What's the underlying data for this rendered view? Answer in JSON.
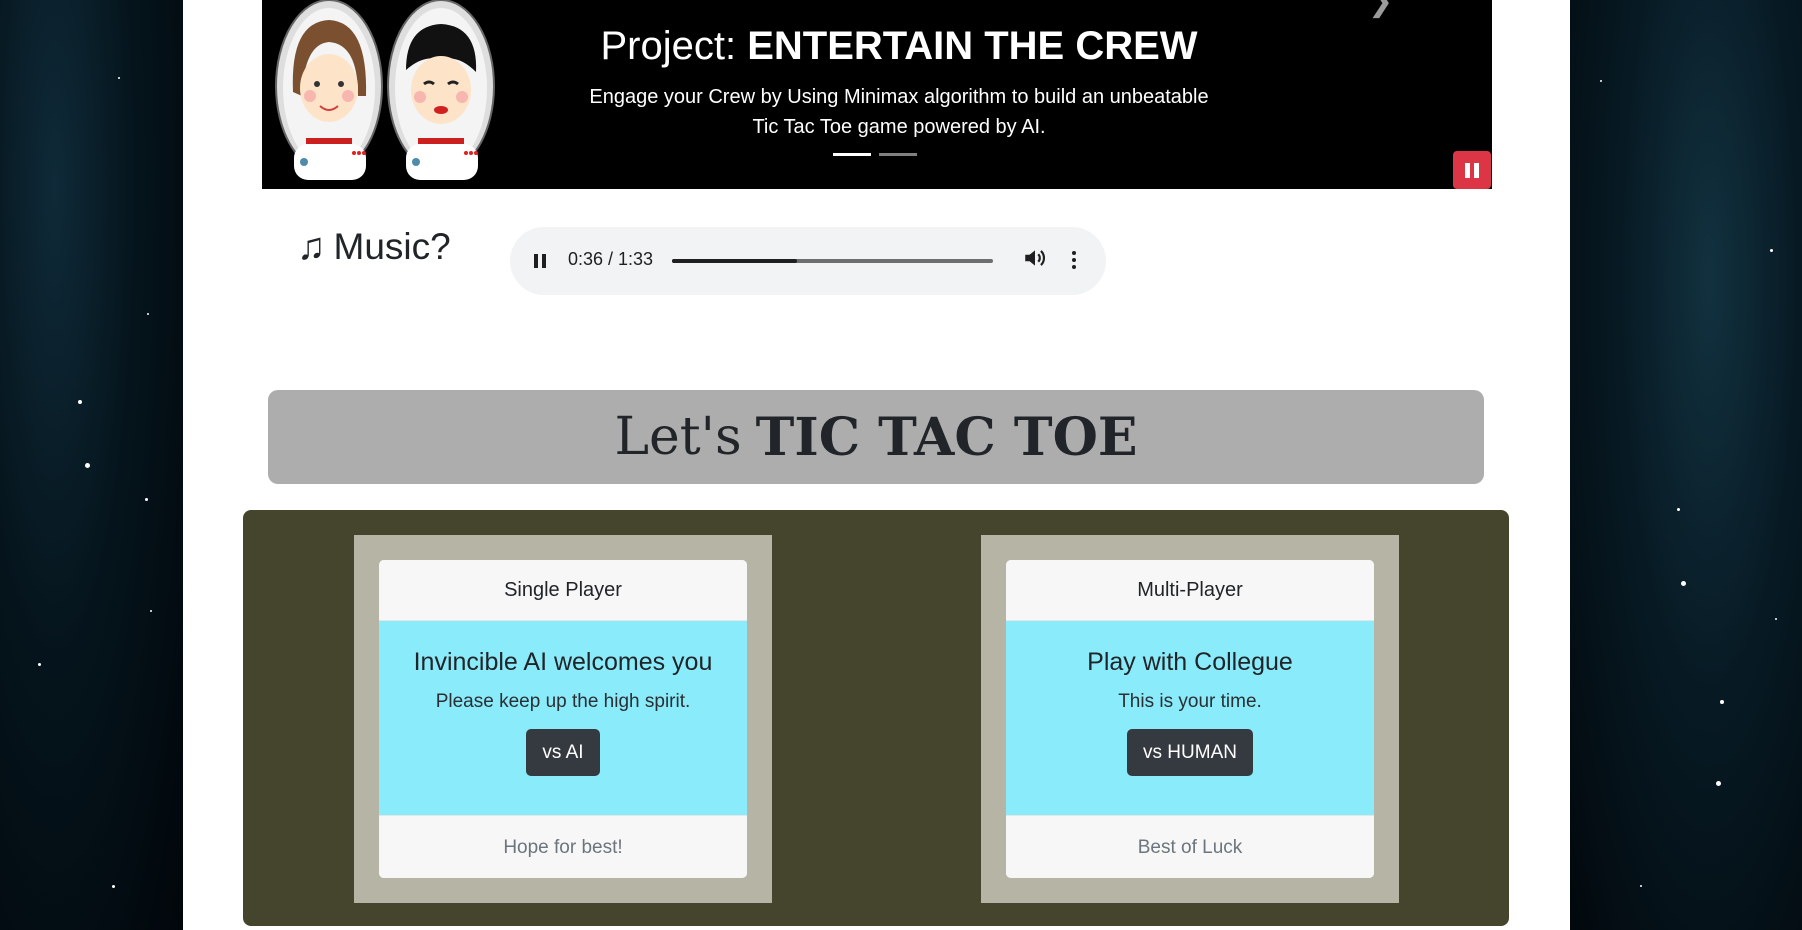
{
  "carousel": {
    "title_prefix": "Project:",
    "title_bold": "ENTERTAIN THE CREW",
    "text_line1": "Engage your Crew by Using Minimax algorithm to build an unbeatable",
    "text_line2": "Tic Tac Toe game powered by AI.",
    "active_slide_index": 0,
    "slide_count": 2
  },
  "music": {
    "label": "Music?",
    "time_display": "0:36 / 1:33",
    "progress_fraction": 0.39
  },
  "banner": {
    "prefix": "Let's",
    "bold": "TIC TAC TOE"
  },
  "cards": [
    {
      "header": "Single Player",
      "title": "Invincible AI welcomes you",
      "text": "Please keep up the high spirit.",
      "button": "vs AI",
      "footer": "Hope for best!"
    },
    {
      "header": "Multi-Player",
      "title": "Play with Collegue",
      "text": "This is your time.",
      "button": "vs HUMAN",
      "footer": "Best of Luck"
    }
  ],
  "colors": {
    "pause_button": "#dc3545",
    "banner_bg": "#adadad",
    "game_bg": "#45442c",
    "card_body": "#8aebfb",
    "button_dark": "#343a40"
  },
  "icons": {
    "music": "music-note-icon",
    "carousel_next": "chevron-right-icon",
    "carousel_pause": "pause-icon",
    "audio_play": "pause-icon",
    "audio_volume": "volume-icon",
    "audio_more": "more-vertical-icon"
  }
}
